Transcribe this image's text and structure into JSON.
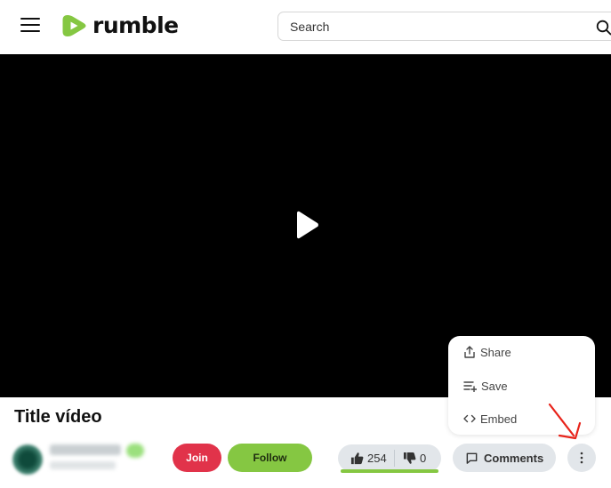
{
  "header": {
    "brand": "rumble",
    "search_placeholder": "Search"
  },
  "video": {
    "title": "Title vídeo"
  },
  "actions": {
    "join_label": "Join",
    "follow_label": "Follow",
    "likes": "254",
    "dislikes": "0",
    "like_ratio": 1.0,
    "comments_label": "Comments"
  },
  "more_menu": {
    "items": [
      {
        "label": "Share",
        "icon": "share-icon"
      },
      {
        "label": "Save",
        "icon": "playlist-add-icon"
      },
      {
        "label": "Embed",
        "icon": "code-icon"
      }
    ]
  },
  "colors": {
    "brand_green": "#85c742",
    "join_red": "#e1334a",
    "pill_gray": "#e2e6ea",
    "annotation_red": "#e8231a"
  },
  "annotation": {
    "type": "red-arrow",
    "points_to": "more-options-button"
  }
}
